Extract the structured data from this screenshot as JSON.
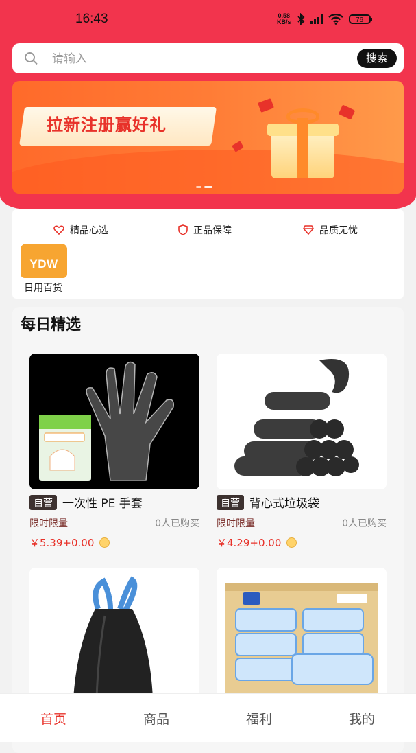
{
  "status_bar": {
    "time": "16:43",
    "net_speed_value": "0.58",
    "net_speed_unit": "KB/s",
    "battery": "76"
  },
  "search": {
    "placeholder": "请输入",
    "button_label": "搜索"
  },
  "banner": {
    "title": "拉新注册赢好礼",
    "active_slide": 2,
    "slide_count": 2
  },
  "features": [
    {
      "label": "精品心选",
      "icon": "heart-icon"
    },
    {
      "label": "正品保障",
      "icon": "shield-icon"
    },
    {
      "label": "品质无忧",
      "icon": "diamond-icon"
    }
  ],
  "categories": [
    {
      "logo_text": "YDW",
      "label": "日用百货"
    }
  ],
  "daily": {
    "title": "每日精选",
    "products": [
      {
        "badge": "自营",
        "name": "一次性 PE 手套",
        "limit": "限时限量",
        "sold": "0人已购买",
        "price": "￥5.39+0.00"
      },
      {
        "badge": "自营",
        "name": "背心式垃圾袋",
        "limit": "限时限量",
        "sold": "0人已购买",
        "price": "￥4.29+0.00"
      }
    ]
  },
  "tabs": [
    {
      "label": "首页",
      "active": true
    },
    {
      "label": "商品",
      "active": false
    },
    {
      "label": "福利",
      "active": false
    },
    {
      "label": "我的",
      "active": false
    }
  ],
  "colors": {
    "brand_red": "#f2344d",
    "price_red": "#e8322a",
    "banner_orange": "#ff7c36",
    "badge_dark": "#3d3230"
  }
}
